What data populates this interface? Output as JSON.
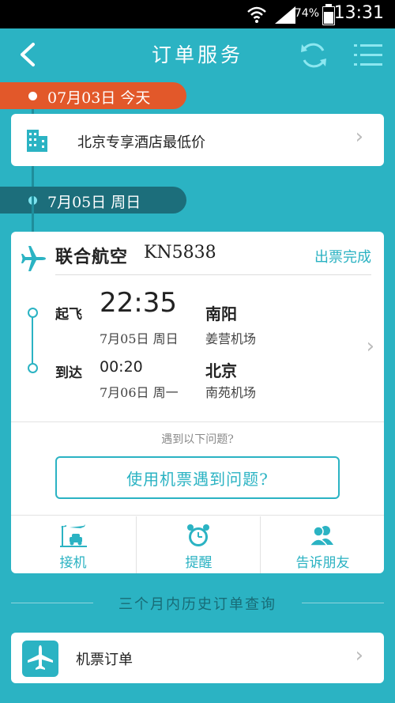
{
  "status_bar": {
    "battery": "74%",
    "time": "13:31"
  },
  "header": {
    "title": "订单服务",
    "back_icon": "chevron-left-icon",
    "refresh_icon": "refresh-icon",
    "menu_icon": "list-menu-icon"
  },
  "today_section": {
    "date_label": "07月03日 今天"
  },
  "hotel_card": {
    "label": "北京专享酒店最低价",
    "icon": "building-icon"
  },
  "flight_section": {
    "date_label": "7月05日 周日"
  },
  "flight_card": {
    "airline": "联合航空",
    "flight_no": "KN5838",
    "status": "出票完成",
    "departure": {
      "label": "起飞",
      "time": "22:35",
      "city": "南阳",
      "date": "7月05日 周日",
      "airport": "姜营机场"
    },
    "arrival": {
      "label": "到达",
      "time": "00:20",
      "city": "北京",
      "date": "7月06日 周一",
      "airport": "南苑机场"
    },
    "problem_hint": "遇到以下问题?",
    "problem_button": "使用机票遇到问题?",
    "actions": [
      {
        "label": "接机",
        "icon": "airport-pickup-icon"
      },
      {
        "label": "提醒",
        "icon": "alarm-clock-icon"
      },
      {
        "label": "告诉朋友",
        "icon": "friends-icon"
      }
    ]
  },
  "history": {
    "label": "三个月内历史订单查询"
  },
  "ticket_card": {
    "label": "机票订单",
    "icon": "airplane-icon"
  },
  "colors": {
    "background": "#2bb3c3",
    "today_pill": "#e2582a",
    "date_pill": "#1c6e7b",
    "accent": "#2ab2c2"
  }
}
